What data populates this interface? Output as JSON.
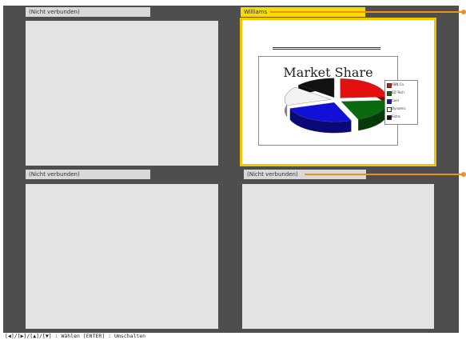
{
  "panes": {
    "top_left": {
      "label": "(Nicht verbunden)"
    },
    "top_right": {
      "label": "Williams",
      "selected": true,
      "slide": {
        "title": "Market Share"
      }
    },
    "bottom_left": {
      "label": "(Nicht verbunden)"
    },
    "bottom_right": {
      "label": "(Nicht verbunden)"
    }
  },
  "chart_data": {
    "type": "pie",
    "title": "Market Share",
    "categories": [
      "ABN Co.",
      "ED Tech",
      "Cool",
      "Dynamic",
      "Extra"
    ],
    "values": [
      24,
      20,
      26,
      16,
      14
    ],
    "colors": [
      "#e31010",
      "#0a6a10",
      "#1010d8",
      "#f2f2f2",
      "#111111"
    ],
    "legend_placement": "right"
  },
  "footer": {
    "hint": "[◀]/[▶]/[▲]/[▼] : Wählen  [ENTER] : Umschalten"
  },
  "colors": {
    "background": "#4e4e4e",
    "label": "#d9d9d9",
    "selected_label": "#f5dd00",
    "selected_border": "#f5c400",
    "callout": "#f0901a",
    "pane": "#e3e3e3"
  }
}
